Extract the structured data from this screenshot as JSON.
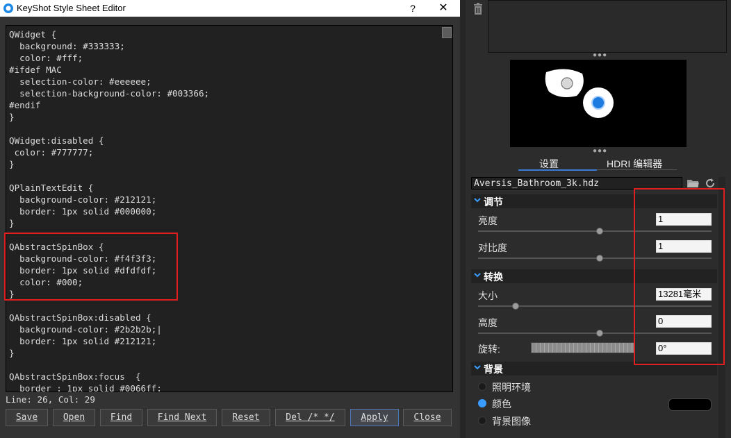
{
  "dialog": {
    "title": "KeyShot Style Sheet Editor",
    "help_label": "?",
    "close_label": "✕",
    "code_lines": [
      "QWidget {",
      "  background: #333333;",
      "  color: #fff;",
      "#ifdef MAC",
      "  selection-color: #eeeeee;",
      "  selection-background-color: #003366;",
      "#endif",
      "}",
      "",
      "QWidget:disabled {",
      " color: #777777;",
      "}",
      "",
      "QPlainTextEdit {",
      "  background-color: #212121;",
      "  border: 1px solid #000000;",
      "}",
      "",
      "QAbstractSpinBox {",
      "  background-color: #f4f3f3;",
      "  border: 1px solid #dfdfdf;",
      "  color: #000;",
      "}",
      "",
      "QAbstractSpinBox:disabled {",
      "  background-color: #2b2b2b;|",
      "  border: 1px solid #212121;",
      "}",
      "",
      "QAbstractSpinBox:focus  {",
      "  border : 1px solid #0066ff;"
    ],
    "status": "Line: 26, Col: 29",
    "buttons": {
      "save": "Save",
      "open": "Open",
      "find": "Find",
      "find_next": "Find Next",
      "reset": "Reset",
      "del_comment": "Del /* */",
      "apply": "Apply",
      "close": "Close"
    }
  },
  "panel": {
    "tabs": {
      "settings": "设置",
      "hdri_editor": "HDRI 编辑器"
    },
    "file_name": "Aversis_Bathroom_3k.hdz",
    "sections": {
      "adjust": {
        "title": "调节",
        "brightness": {
          "label": "亮度",
          "value": "1",
          "slider_fraction": 0.52
        },
        "contrast": {
          "label": "对比度",
          "value": "1",
          "slider_fraction": 0.52
        }
      },
      "transform": {
        "title": "转换",
        "size": {
          "label": "大小",
          "value": "13281毫米",
          "slider_fraction": 0.16
        },
        "height": {
          "label": "高度",
          "value": "0",
          "slider_fraction": 0.52
        },
        "rotation": {
          "label": "旋转:",
          "value": "0°"
        }
      },
      "background": {
        "title": "背景",
        "options": [
          "照明环境",
          "颜色",
          "背景图像"
        ],
        "selected": "颜色",
        "color": "#000000"
      }
    }
  },
  "colors": {
    "highlight": "#e02020",
    "accent": "#3a7bd5",
    "radio_on": "#3a9cff"
  }
}
